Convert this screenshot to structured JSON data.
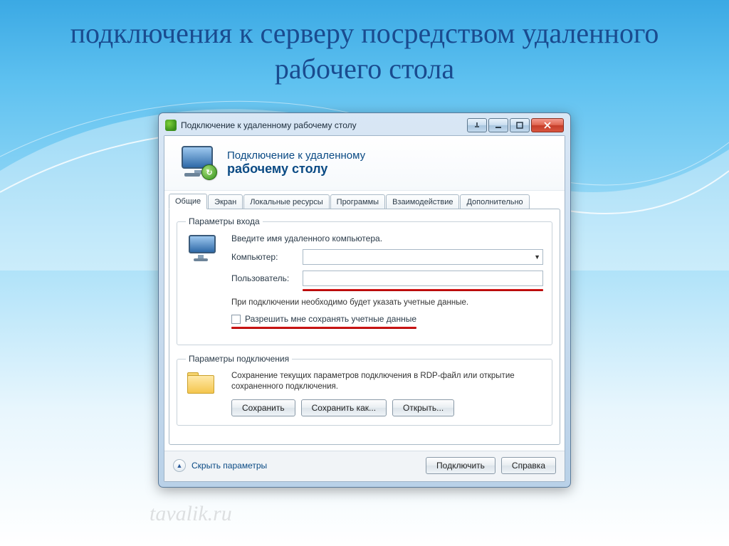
{
  "slide": {
    "title": "подключения к серверу посредством удаленного рабочего стола"
  },
  "window": {
    "title": "Подключение к удаленному рабочему столу",
    "caption": {
      "pin": "pin",
      "min": "minimize",
      "max": "maximize",
      "close": "close"
    }
  },
  "banner": {
    "line1": "Подключение к удаленному",
    "line2": "рабочему столу"
  },
  "tabs": [
    {
      "label": "Общие",
      "active": true
    },
    {
      "label": "Экран",
      "active": false
    },
    {
      "label": "Локальные ресурсы",
      "active": false
    },
    {
      "label": "Программы",
      "active": false
    },
    {
      "label": "Взаимодействие",
      "active": false
    },
    {
      "label": "Дополнительно",
      "active": false
    }
  ],
  "login_group": {
    "legend": "Параметры входа",
    "instruction": "Введите имя удаленного компьютера.",
    "computer_label": "Компьютер:",
    "computer_value": "",
    "user_label": "Пользователь:",
    "user_value": "",
    "help": "При подключении необходимо будет указать учетные данные.",
    "save_creds_label": "Разрешить мне сохранять учетные данные"
  },
  "conn_group": {
    "legend": "Параметры подключения",
    "text": "Сохранение текущих параметров подключения в RDP-файл или открытие сохраненного подключения.",
    "save": "Сохранить",
    "save_as": "Сохранить как...",
    "open": "Открыть..."
  },
  "footer": {
    "hide_options": "Скрыть параметры",
    "connect": "Подключить",
    "help": "Справка"
  },
  "watermark": "tavalik.ru"
}
